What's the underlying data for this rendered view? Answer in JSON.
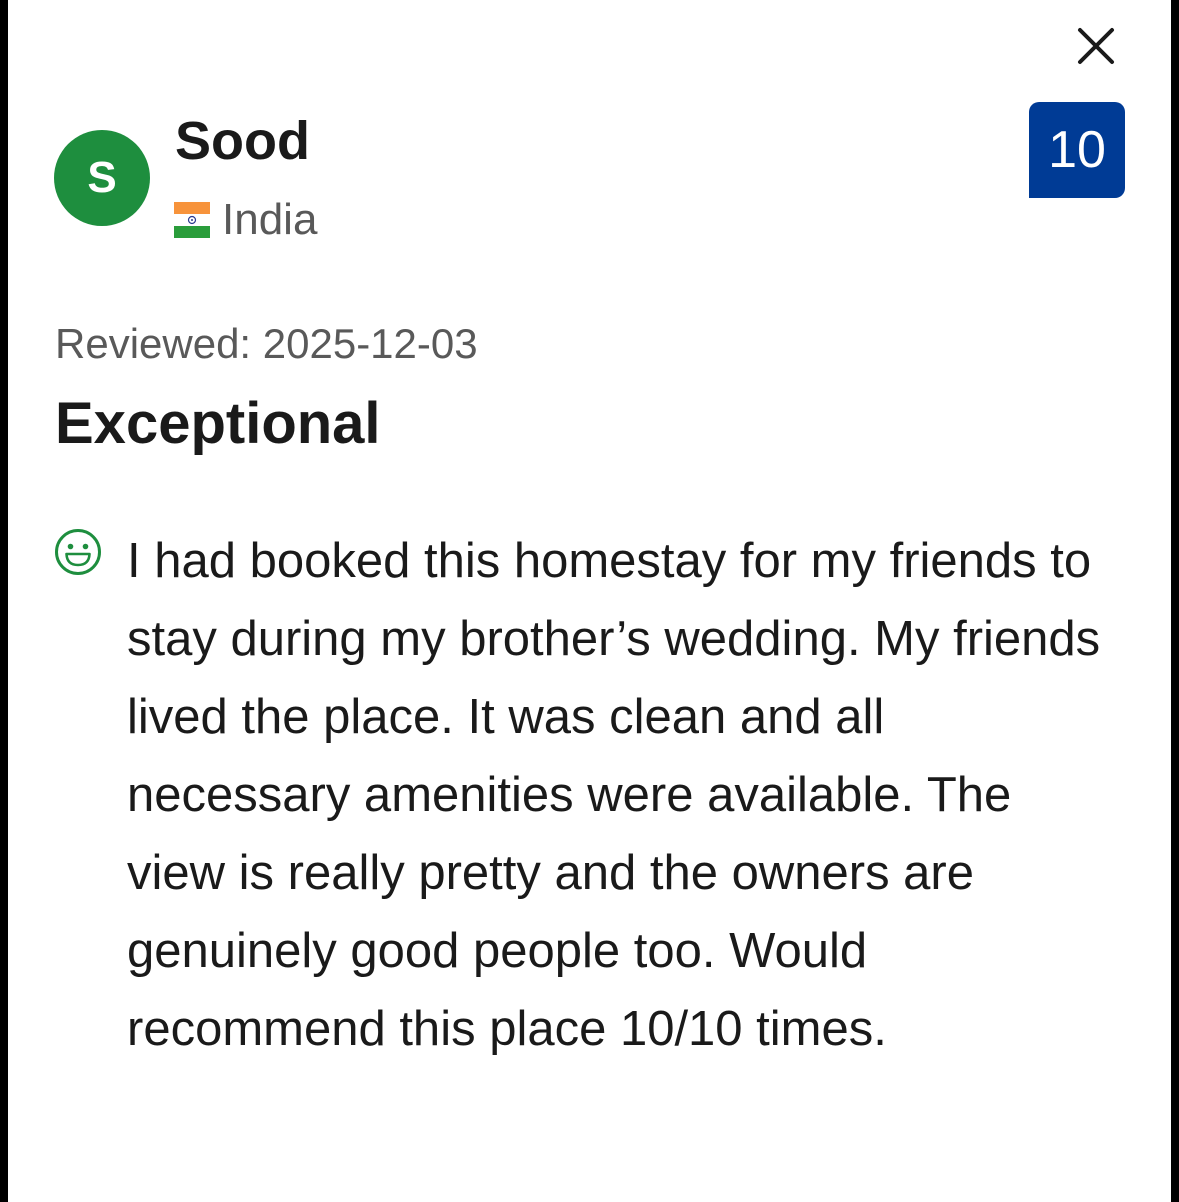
{
  "reviewer": {
    "initial": "S",
    "name": "Sood",
    "country": "India"
  },
  "score": "10",
  "review": {
    "date_text": "Reviewed: 2025-12-03",
    "title": "Exceptional",
    "positive_text": "I had booked this homestay for my friends to stay during my brother’s wedding. My friends lived the place. It was clean and all necessary amenities were available. The view is really pretty and the owners are genuinely good people too. Would recommend this place 10/10 times."
  },
  "icons": {
    "close": "close-icon",
    "flag": "india-flag-icon",
    "positive": "smile-icon"
  },
  "colors": {
    "avatar_bg": "#1e8e3e",
    "score_bg": "#003b95",
    "positive_icon": "#1e8e3e",
    "text_primary": "#1a1a1a",
    "text_secondary": "#595959"
  }
}
